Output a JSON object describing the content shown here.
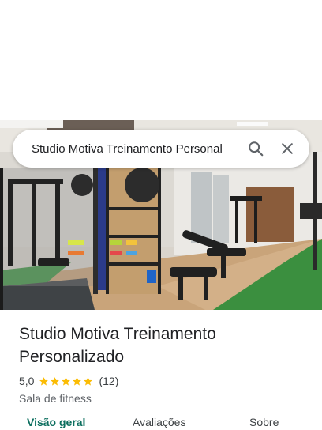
{
  "search": {
    "query": "Studio Motiva Treinamento Personal",
    "search_icon": "search-icon",
    "close_icon": "close-icon"
  },
  "hero": {
    "description_icon": "gym-photo"
  },
  "place": {
    "title": "Studio Motiva Treinamento Personalizado",
    "rating": "5,0",
    "stars": 5,
    "review_count": "(12)",
    "category": "Sala de fitness"
  },
  "tabs": [
    {
      "label": "Visão geral",
      "active": true
    },
    {
      "label": "Avaliações",
      "active": false
    },
    {
      "label": "Sobre",
      "active": false
    }
  ],
  "colors": {
    "accent": "#0b6e5e",
    "star": "#fbbc04",
    "text": "#202124",
    "muted": "#5f6368"
  }
}
